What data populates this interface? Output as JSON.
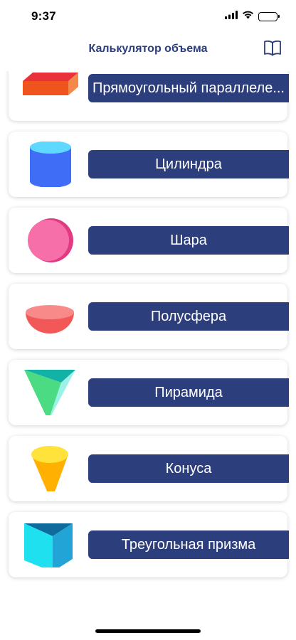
{
  "status_bar": {
    "time": "9:37"
  },
  "nav": {
    "title": "Калькулятор объема",
    "icon": "book-icon"
  },
  "shapes": [
    {
      "label": "Прямоугольный параллеле...",
      "icon": "box-icon",
      "color": "#f0541e"
    },
    {
      "label": "Цилиндра",
      "icon": "cylinder-icon",
      "color": "#3f6df5"
    },
    {
      "label": "Шара",
      "icon": "sphere-icon",
      "color": "#f66fa8"
    },
    {
      "label": "Полусфера",
      "icon": "hemisphere-icon",
      "color": "#f25858"
    },
    {
      "label": "Пирамида",
      "icon": "pyramid-icon",
      "color": "#2ed6a6"
    },
    {
      "label": "Конуса",
      "icon": "cone-icon",
      "color": "#ffc21a"
    },
    {
      "label": "Треугольная призма",
      "icon": "prism-icon",
      "color": "#1fc6e6"
    }
  ],
  "colors": {
    "accent": "#2c3e7b",
    "background": "#ffffff"
  }
}
